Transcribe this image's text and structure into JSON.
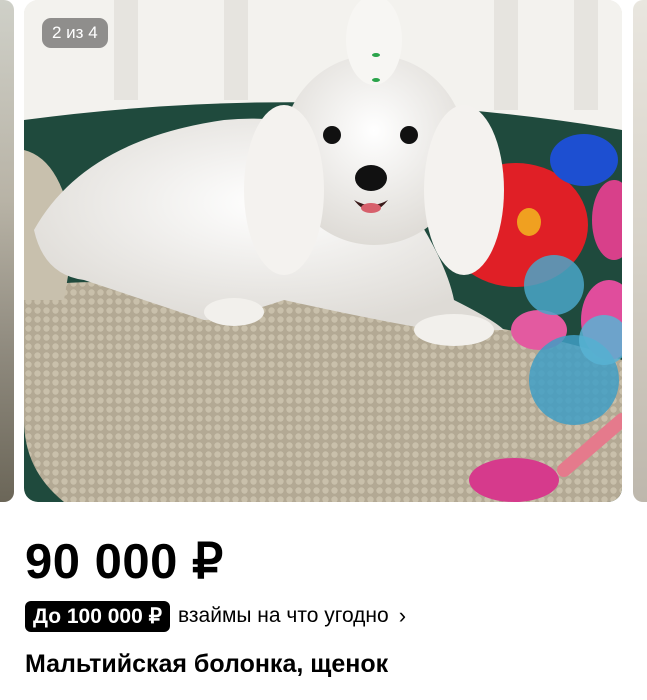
{
  "gallery": {
    "counter": "2 из 4",
    "image_subject": "white maltese puppy on dog bed with toys"
  },
  "listing": {
    "price": "90 000 ₽",
    "loan_badge": "До 100 000 ₽",
    "loan_text": "взаймы на что угодно",
    "title": "Мальтийская болонка, щенок"
  },
  "icons": {
    "chevron": "chevron-right-icon"
  }
}
